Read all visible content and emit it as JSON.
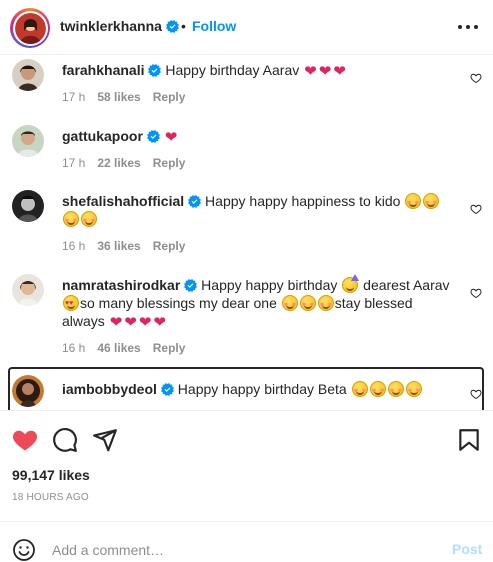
{
  "header": {
    "username": "twinklerkhanna",
    "separator": "•",
    "follow_label": "Follow"
  },
  "comments": [
    {
      "username": "farahkhanali",
      "text": "Happy birthday Aarav",
      "emojis": [
        "red-heart",
        "red-heart",
        "red-heart"
      ],
      "time": "17 h",
      "likes": "58 likes",
      "reply": "Reply"
    },
    {
      "username": "gattukapoor",
      "text": "",
      "emojis": [
        "red-heart"
      ],
      "time": "17 h",
      "likes": "22 likes",
      "reply": "Reply"
    },
    {
      "username": "shefalishahofficial",
      "text": "Happy happy happiness to kido",
      "emojis": [
        "smiling-face-with-smiling-eyes",
        "smiling-face-with-smiling-eyes",
        "smiling-face-with-smiling-eyes",
        "smiling-face-with-smiling-eyes"
      ],
      "time": "16 h",
      "likes": "36 likes",
      "reply": "Reply"
    },
    {
      "username": "namratashirodkar",
      "text_1": "Happy happy birthday",
      "text_2": "dearest Aarav",
      "text_3": "so many blessings my dear one",
      "text_4": "stay blessed",
      "text_5": "always",
      "time": "16 h",
      "likes": "46 likes",
      "reply": "Reply"
    },
    {
      "username": "iambobbydeol",
      "text": "Happy happy birthday Beta",
      "emojis": [
        "smiling-face-with-smiling-eyes",
        "smiling-face-with-smiling-eyes",
        "smiling-face-with-smiling-eyes",
        "smiling-face-with-smiling-eyes"
      ]
    }
  ],
  "post": {
    "likes_count": "99,147 likes",
    "timestamp": "18 HOURS AGO",
    "liked": true
  },
  "add_comment": {
    "placeholder": "Add a comment…",
    "post_label": "Post"
  },
  "icons": {
    "verified": "verified-badge-icon",
    "more": "more-options-icon",
    "like": "heart-icon",
    "comment": "comment-icon",
    "share": "share-icon",
    "save": "bookmark-icon",
    "emoji": "emoji-icon"
  },
  "colors": {
    "accent": "#0095f6",
    "like_red": "#ed4956",
    "post_disabled": "#b2dffc",
    "muted": "#8e8e8e"
  }
}
